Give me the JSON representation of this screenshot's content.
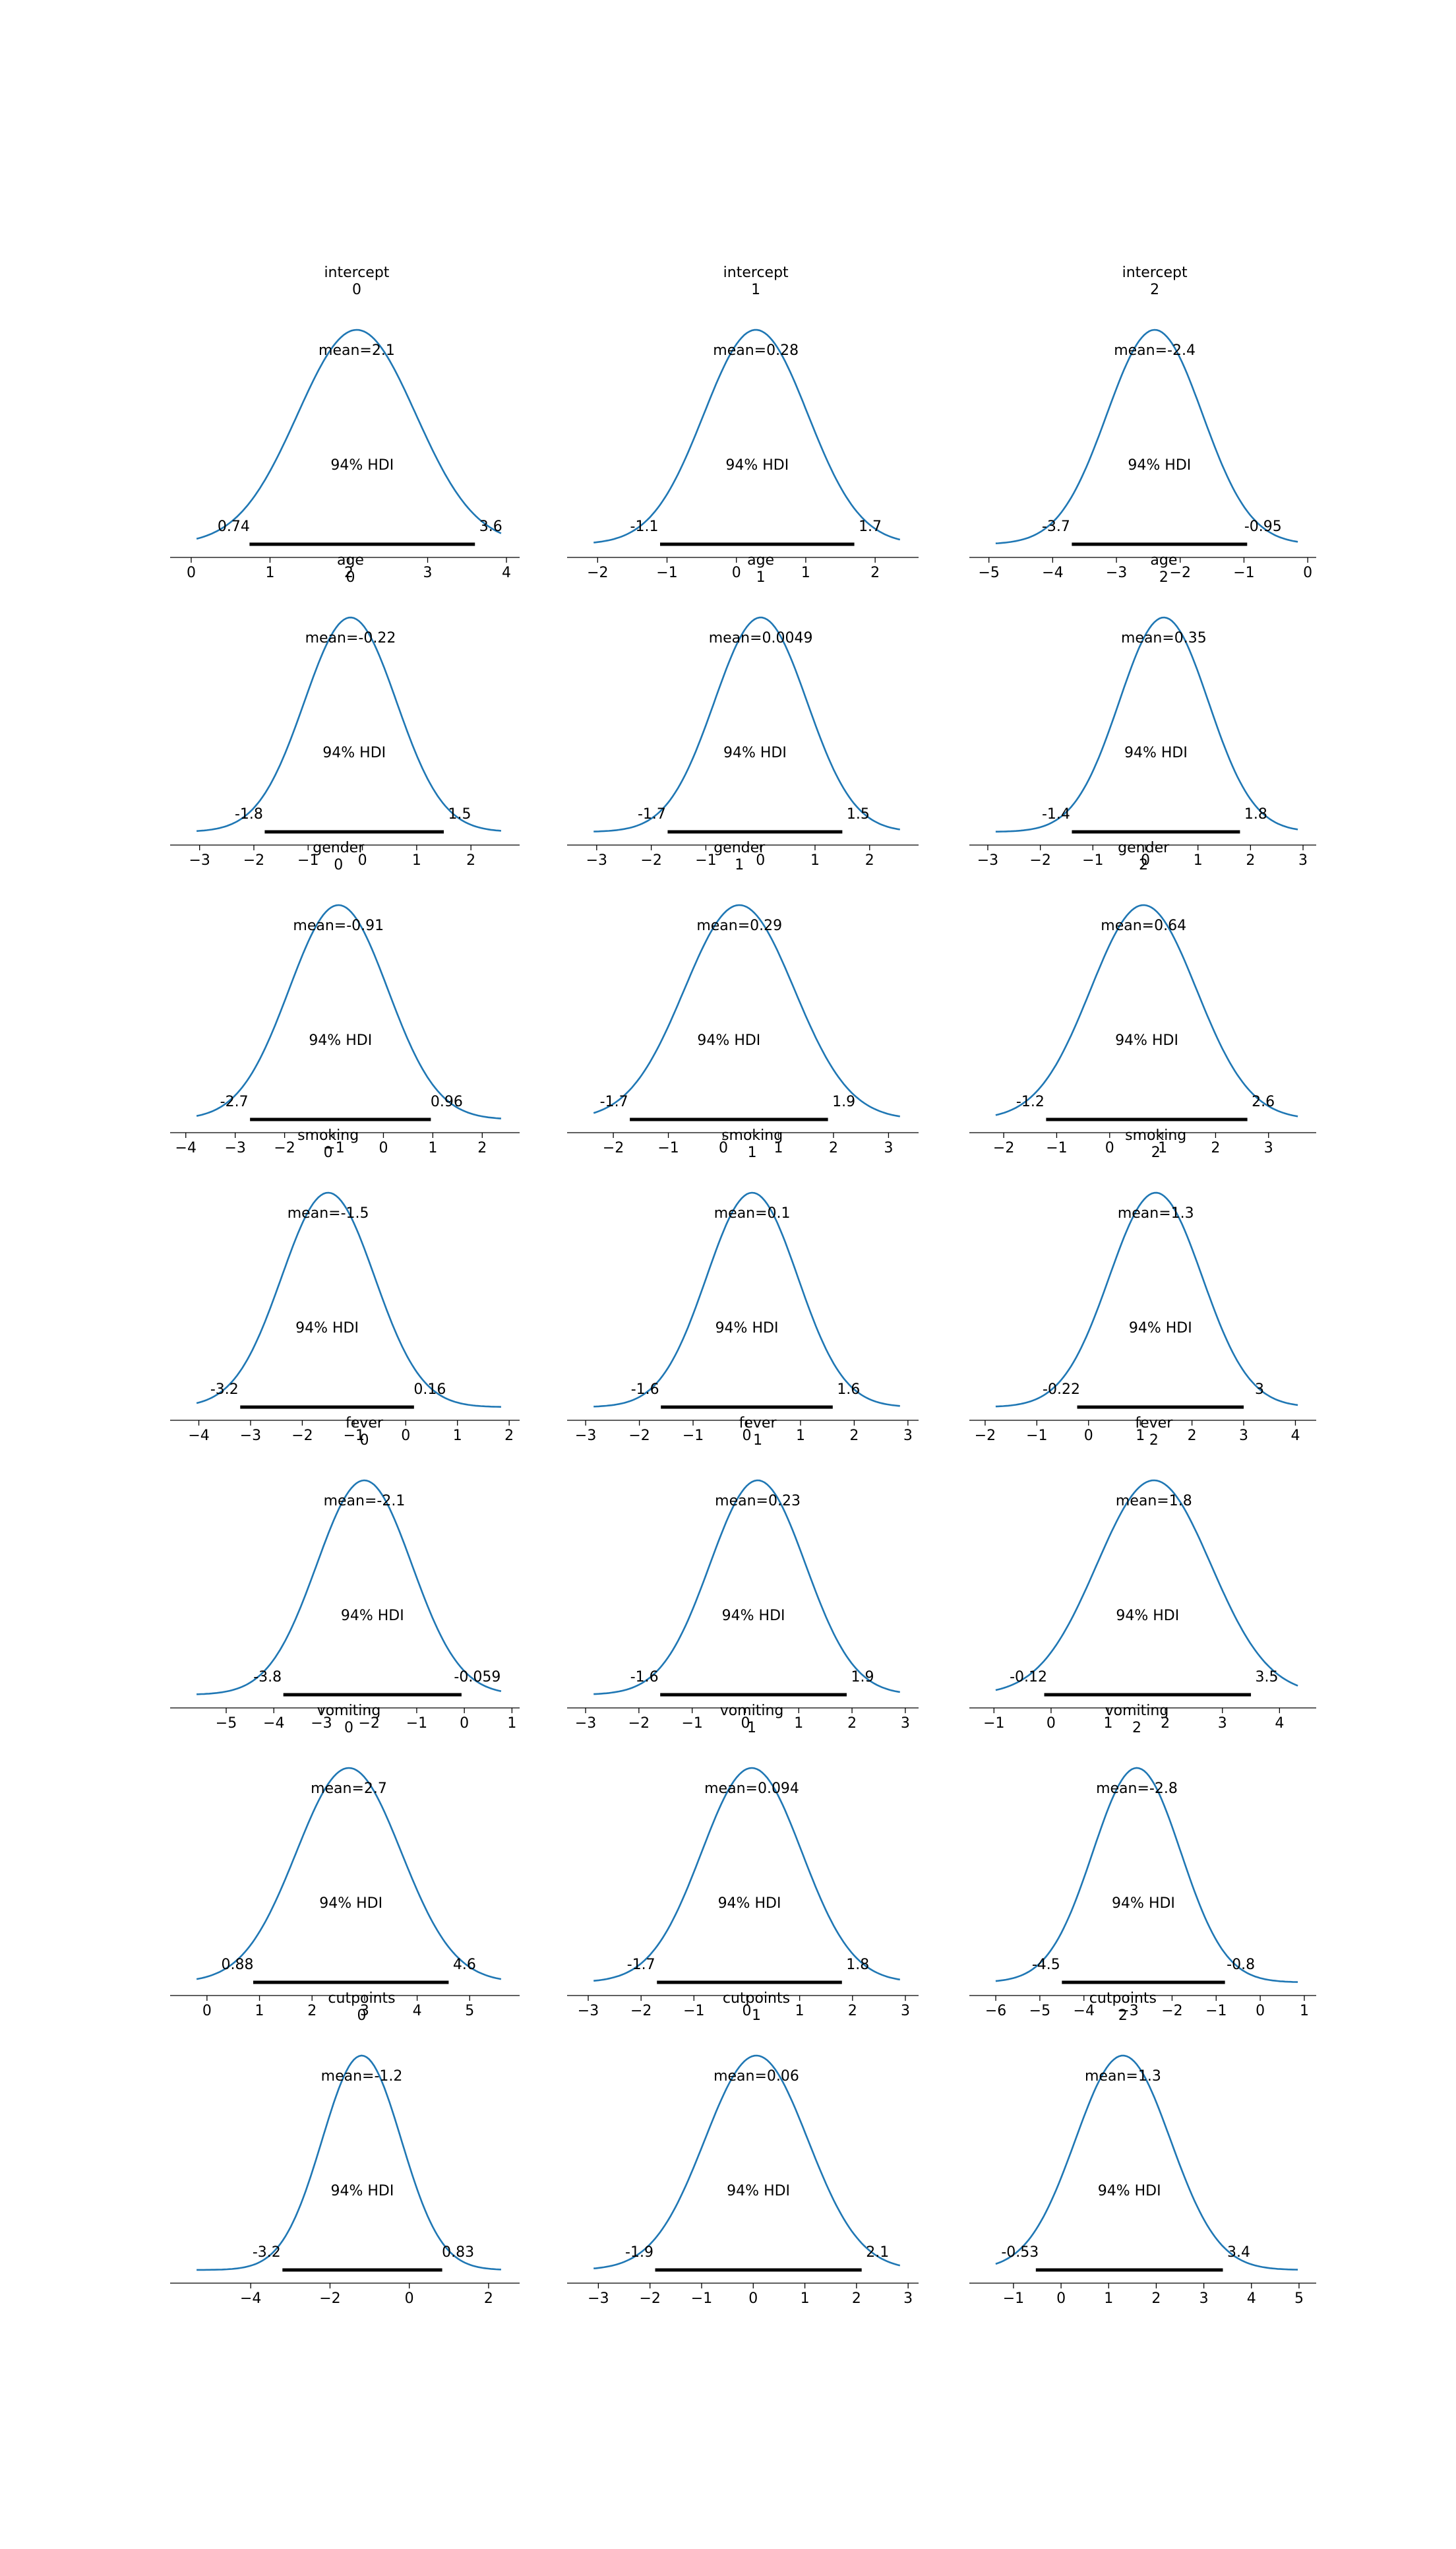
{
  "figure": {
    "hdi_label": "94% HDI",
    "line_color": "#1f77b4",
    "hdi_color": "#000000",
    "grid": false,
    "rows": 7,
    "cols": 3
  },
  "chart_data": [
    {
      "type": "line",
      "var": "intercept",
      "idx": "0",
      "mean": "mean=2.1",
      "mu": 2.1,
      "sd": 0.75,
      "hdi": [
        0.74,
        3.6
      ],
      "hdi_labels": [
        "0.74",
        "3.6"
      ],
      "xlim": [
        -0.1,
        4.1
      ],
      "ticks": [
        0,
        1,
        2,
        3,
        4
      ]
    },
    {
      "type": "line",
      "var": "intercept",
      "idx": "1",
      "mean": "mean=0.28",
      "mu": 0.28,
      "sd": 0.75,
      "hdi": [
        -1.1,
        1.7
      ],
      "hdi_labels": [
        "-1.1",
        "1.7"
      ],
      "xlim": [
        -2.25,
        2.55
      ],
      "ticks": [
        -2,
        -1,
        0,
        1,
        2
      ]
    },
    {
      "type": "line",
      "var": "intercept",
      "idx": "2",
      "mean": "mean=-2.4",
      "mu": -2.4,
      "sd": 0.75,
      "hdi": [
        -3.7,
        -0.95
      ],
      "hdi_labels": [
        "-3.7",
        "-0.95"
      ],
      "xlim": [
        -5.1,
        0.05
      ],
      "ticks": [
        -5,
        -4,
        -3,
        -2,
        -1,
        0
      ]
    },
    {
      "type": "line",
      "var": "age",
      "idx": "0",
      "mean": "mean=-0.22",
      "mu": -0.22,
      "sd": 0.85,
      "hdi": [
        -1.8,
        1.5
      ],
      "hdi_labels": [
        "-1.8",
        "1.5"
      ],
      "xlim": [
        -3.3,
        2.8
      ],
      "ticks": [
        -3,
        -2,
        -1,
        0,
        1,
        2
      ]
    },
    {
      "type": "line",
      "var": "age",
      "idx": "1",
      "mean": "mean=0.0049",
      "mu": 0.0049,
      "sd": 0.85,
      "hdi": [
        -1.7,
        1.5
      ],
      "hdi_labels": [
        "-1.7",
        "1.5"
      ],
      "xlim": [
        -3.3,
        2.8
      ],
      "ticks": [
        -3,
        -2,
        -1,
        0,
        1,
        2
      ]
    },
    {
      "type": "line",
      "var": "age",
      "idx": "2",
      "mean": "mean=0.35",
      "mu": 0.35,
      "sd": 0.85,
      "hdi": [
        -1.4,
        1.8
      ],
      "hdi_labels": [
        "-1.4",
        "1.8"
      ],
      "xlim": [
        -3.1,
        3.15
      ],
      "ticks": [
        -3,
        -2,
        -1,
        0,
        1,
        2,
        3
      ]
    },
    {
      "type": "line",
      "var": "gender",
      "idx": "0",
      "mean": "mean=-0.91",
      "mu": -0.91,
      "sd": 1.0,
      "hdi": [
        -2.7,
        0.96
      ],
      "hdi_labels": [
        "-2.7",
        "0.96"
      ],
      "xlim": [
        -4.05,
        2.65
      ],
      "ticks": [
        -4,
        -3,
        -2,
        -1,
        0,
        1,
        2
      ]
    },
    {
      "type": "line",
      "var": "gender",
      "idx": "1",
      "mean": "mean=0.29",
      "mu": 0.29,
      "sd": 1.0,
      "hdi": [
        -1.7,
        1.9
      ],
      "hdi_labels": [
        "-1.7",
        "1.9"
      ],
      "xlim": [
        -2.6,
        3.45
      ],
      "ticks": [
        -2,
        -1,
        0,
        1,
        2,
        3
      ]
    },
    {
      "type": "line",
      "var": "gender",
      "idx": "2",
      "mean": "mean=0.64",
      "mu": 0.64,
      "sd": 1.0,
      "hdi": [
        -1.2,
        2.6
      ],
      "hdi_labels": [
        "-1.2",
        "2.6"
      ],
      "xlim": [
        -2.4,
        3.8
      ],
      "ticks": [
        -2,
        -1,
        0,
        1,
        2,
        3
      ]
    },
    {
      "type": "line",
      "var": "smoking",
      "idx": "0",
      "mean": "mean=-1.5",
      "mu": -1.5,
      "sd": 0.9,
      "hdi": [
        -3.2,
        0.16
      ],
      "hdi_labels": [
        "-3.2",
        "0.16"
      ],
      "xlim": [
        -4.3,
        2.1
      ],
      "ticks": [
        -4,
        -3,
        -2,
        -1,
        0,
        1,
        2
      ]
    },
    {
      "type": "line",
      "var": "smoking",
      "idx": "1",
      "mean": "mean=0.1",
      "mu": 0.1,
      "sd": 0.85,
      "hdi": [
        -1.6,
        1.6
      ],
      "hdi_labels": [
        "-1.6",
        "1.6"
      ],
      "xlim": [
        -3.1,
        3.1
      ],
      "ticks": [
        -3,
        -2,
        -1,
        0,
        1,
        2,
        3
      ]
    },
    {
      "type": "line",
      "var": "smoking",
      "idx": "2",
      "mean": "mean=1.3",
      "mu": 1.3,
      "sd": 0.9,
      "hdi": [
        -0.22,
        3.0
      ],
      "hdi_labels": [
        "-0.22",
        "3"
      ],
      "xlim": [
        -2.05,
        4.3
      ],
      "ticks": [
        -2,
        -1,
        0,
        1,
        2,
        3,
        4
      ]
    },
    {
      "type": "line",
      "var": "fever",
      "idx": "0",
      "mean": "mean=-2.1",
      "mu": -2.1,
      "sd": 1.0,
      "hdi": [
        -3.8,
        -0.059
      ],
      "hdi_labels": [
        "-3.8",
        "-0.059"
      ],
      "xlim": [
        -5.9,
        1.05
      ],
      "ticks": [
        -5,
        -4,
        -3,
        -2,
        -1,
        0,
        1
      ]
    },
    {
      "type": "line",
      "var": "fever",
      "idx": "1",
      "mean": "mean=0.23",
      "mu": 0.23,
      "sd": 0.9,
      "hdi": [
        -1.6,
        1.9
      ],
      "hdi_labels": [
        "-1.6",
        "1.9"
      ],
      "xlim": [
        -3.1,
        3.15
      ],
      "ticks": [
        -3,
        -2,
        -1,
        0,
        1,
        2,
        3
      ]
    },
    {
      "type": "line",
      "var": "fever",
      "idx": "2",
      "mean": "mean=1.8",
      "mu": 1.8,
      "sd": 1.0,
      "hdi": [
        -0.12,
        3.5
      ],
      "hdi_labels": [
        "-0.12",
        "3.5"
      ],
      "xlim": [
        -1.2,
        4.55
      ],
      "ticks": [
        -1,
        0,
        1,
        2,
        3,
        4
      ]
    },
    {
      "type": "line",
      "var": "vomiting",
      "idx": "0",
      "mean": "mean=2.7",
      "mu": 2.7,
      "sd": 1.0,
      "hdi": [
        0.88,
        4.6
      ],
      "hdi_labels": [
        "0.88",
        "4.6"
      ],
      "xlim": [
        -0.45,
        5.85
      ],
      "ticks": [
        0,
        1,
        2,
        3,
        4,
        5
      ]
    },
    {
      "type": "line",
      "var": "vomiting",
      "idx": "1",
      "mean": "mean=0.094",
      "mu": 0.094,
      "sd": 0.95,
      "hdi": [
        -1.7,
        1.8
      ],
      "hdi_labels": [
        "-1.7",
        "1.8"
      ],
      "xlim": [
        -3.15,
        3.15
      ],
      "ticks": [
        -3,
        -2,
        -1,
        0,
        1,
        2,
        3
      ]
    },
    {
      "type": "line",
      "var": "vomiting",
      "idx": "2",
      "mean": "mean=-2.8",
      "mu": -2.8,
      "sd": 1.0,
      "hdi": [
        -4.5,
        -0.8
      ],
      "hdi_labels": [
        "-4.5",
        "-0.8"
      ],
      "xlim": [
        -6.3,
        1.15
      ],
      "ticks": [
        -6,
        -5,
        -4,
        -3,
        -2,
        -1,
        0,
        1
      ]
    },
    {
      "type": "line",
      "var": "cutpoints",
      "idx": "0",
      "mean": "mean=-1.2",
      "mu": -1.2,
      "sd": 1.0,
      "hdi": [
        -3.2,
        0.83
      ],
      "hdi_labels": [
        "-3.2",
        "0.83"
      ],
      "xlim": [
        -5.7,
        2.65
      ],
      "ticks": [
        -4,
        -2,
        0,
        2
      ]
    },
    {
      "type": "line",
      "var": "cutpoints",
      "idx": "1",
      "mean": "mean=0.06",
      "mu": 0.06,
      "sd": 1.0,
      "hdi": [
        -1.9,
        2.1
      ],
      "hdi_labels": [
        "-1.9",
        "2.1"
      ],
      "xlim": [
        -3.35,
        3.1
      ],
      "ticks": [
        -3,
        -2,
        -1,
        0,
        1,
        2,
        3
      ]
    },
    {
      "type": "line",
      "var": "cutpoints",
      "idx": "2",
      "mean": "mean=1.3",
      "mu": 1.3,
      "sd": 1.0,
      "hdi": [
        -0.53,
        3.4
      ],
      "hdi_labels": [
        "-0.53",
        "3.4"
      ],
      "xlim": [
        -1.65,
        5.25
      ],
      "ticks": [
        -1,
        0,
        1,
        2,
        3,
        4,
        5
      ]
    }
  ]
}
